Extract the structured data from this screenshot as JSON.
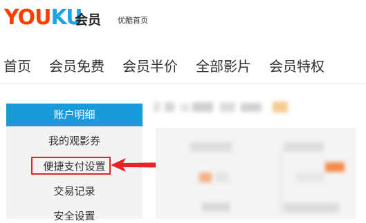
{
  "header": {
    "logo_part1": "YOU",
    "logo_part2": "KU",
    "member_label": "会员",
    "home_link": "优酷首页"
  },
  "nav": {
    "items": [
      "首页",
      "会员免费",
      "会员半价",
      "全部影片",
      "会员特权"
    ]
  },
  "sidebar": {
    "items": [
      {
        "label": "账户明细",
        "active": true
      },
      {
        "label": "我的观影券",
        "active": false
      },
      {
        "label": "便捷支付设置",
        "active": false,
        "highlighted": true
      },
      {
        "label": "交易记录",
        "active": false
      },
      {
        "label": "安全设置",
        "active": false
      }
    ]
  },
  "colors": {
    "brand_red": "#ff3d00",
    "brand_blue": "#1aa3e6",
    "active_bg": "#1a9ad9",
    "annotation_red": "#e8222a"
  }
}
